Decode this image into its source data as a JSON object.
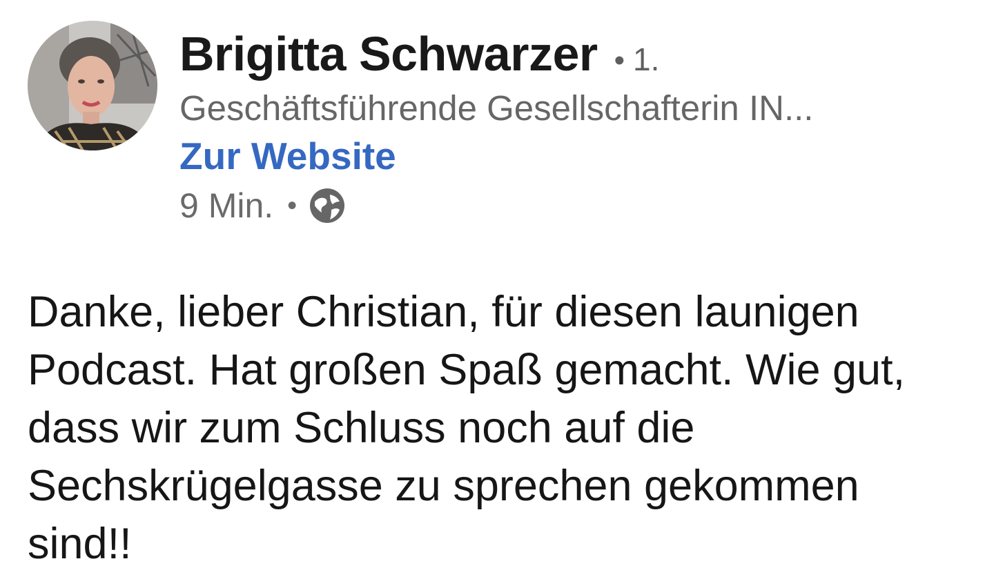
{
  "author": {
    "name": "Brigitta Schwarzer",
    "separator": "•",
    "connection_degree": "1.",
    "headline": "Geschäftsführende Gesellschafterin IN...",
    "website_link_label": "Zur Website"
  },
  "meta": {
    "time_ago": "9 Min.",
    "separator": "•",
    "visibility_icon": "globe-icon"
  },
  "post": {
    "text": "Danke, lieber Christian, für diesen launigen Podcast. Hat großen Spaß gemacht. Wie gut, dass wir zum Schluss noch auf die Sechskrügelgasse zu sprechen gekommen sind!!"
  },
  "colors": {
    "link": "#3568c1",
    "secondary_text": "#666666",
    "primary_text": "#191919"
  }
}
